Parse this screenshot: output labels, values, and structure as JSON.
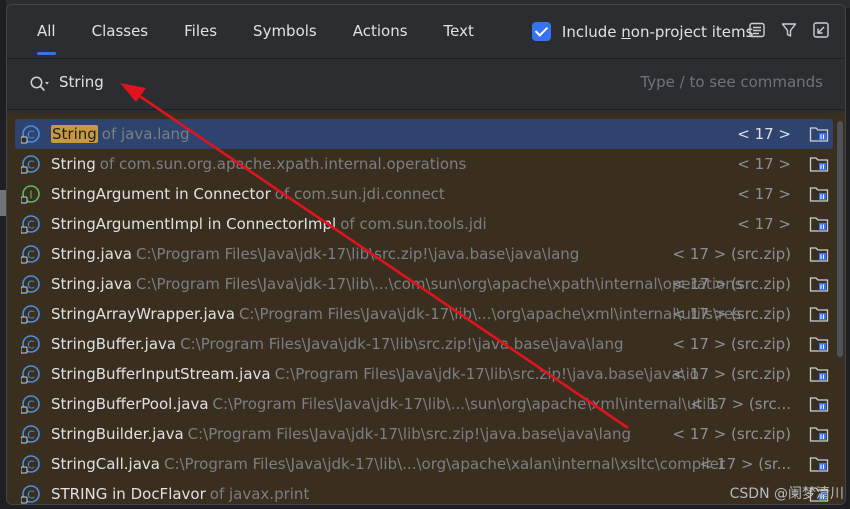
{
  "tabs": [
    {
      "label": "All",
      "active": true
    },
    {
      "label": "Classes",
      "active": false
    },
    {
      "label": "Files",
      "active": false
    },
    {
      "label": "Symbols",
      "active": false
    },
    {
      "label": "Actions",
      "active": false
    },
    {
      "label": "Text",
      "active": false
    }
  ],
  "include_option": {
    "label_pre": "Include ",
    "label_u": "n",
    "label_post": "on-project items",
    "checked": true
  },
  "toolbar_icons": [
    "preview-icon",
    "filter-icon",
    "open-in-window-icon"
  ],
  "search": {
    "value": "String",
    "hint": "Type / to see commands"
  },
  "results": [
    {
      "icon": "class",
      "name_hl": "String",
      "name": "",
      "loc": "of java.lang",
      "ver": "< 17 >",
      "selected": true
    },
    {
      "icon": "class",
      "name_hl": "",
      "name": "String",
      "loc": "of com.sun.org.apache.xpath.internal.operations",
      "ver": "< 17 >",
      "selected": false
    },
    {
      "icon": "interface",
      "name_hl": "",
      "name": "StringArgument in Connector",
      "loc": "of com.sun.jdi.connect",
      "ver": "< 17 >",
      "selected": false
    },
    {
      "icon": "class",
      "name_hl": "",
      "name": "StringArgumentImpl in ConnectorImpl",
      "loc": "of com.sun.tools.jdi",
      "ver": "< 17 >",
      "selected": false
    },
    {
      "icon": "class",
      "name_hl": "",
      "name": "String.java",
      "loc": "C:\\Program Files\\Java\\jdk-17\\lib\\src.zip!\\java.base\\java\\lang",
      "ver": "< 17 > (src.zip)",
      "selected": false
    },
    {
      "icon": "class",
      "name_hl": "",
      "name": "String.java",
      "loc": "C:\\Program Files\\Java\\jdk-17\\lib\\...\\com\\sun\\org\\apache\\xpath\\internal\\operations",
      "ver": "< 17 > (src.zip)",
      "selected": false
    },
    {
      "icon": "class",
      "name_hl": "",
      "name": "StringArrayWrapper.java",
      "loc": "C:\\Program Files\\Java\\jdk-17\\lib\\...\\org\\apache\\xml\\internal\\utils\\res",
      "ver": "< 17 > (src.zip)",
      "selected": false
    },
    {
      "icon": "class",
      "name_hl": "",
      "name": "StringBuffer.java",
      "loc": "C:\\Program Files\\Java\\jdk-17\\lib\\src.zip!\\java.base\\java\\lang",
      "ver": "< 17 > (src.zip)",
      "selected": false
    },
    {
      "icon": "class",
      "name_hl": "",
      "name": "StringBufferInputStream.java",
      "loc": "C:\\Program Files\\Java\\jdk-17\\lib\\src.zip!\\java.base\\java\\io",
      "ver": "< 17 > (src.zip)",
      "selected": false
    },
    {
      "icon": "class",
      "name_hl": "",
      "name": "StringBufferPool.java",
      "loc": "C:\\Program Files\\Java\\jdk-17\\lib\\...\\sun\\org\\apache\\xml\\internal\\utils",
      "ver": "< 17 > (src...",
      "selected": false
    },
    {
      "icon": "class",
      "name_hl": "",
      "name": "StringBuilder.java",
      "loc": "C:\\Program Files\\Java\\jdk-17\\lib\\src.zip!\\java.base\\java\\lang",
      "ver": "< 17 > (src.zip)",
      "selected": false
    },
    {
      "icon": "class",
      "name_hl": "",
      "name": "StringCall.java",
      "loc": "C:\\Program Files\\Java\\jdk-17\\lib\\...\\org\\apache\\xalan\\internal\\xsltc\\compiler",
      "ver": "< 17 > (sr...",
      "selected": false
    },
    {
      "icon": "class",
      "name_hl": "",
      "name": "STRING in DocFlavor",
      "loc": "of javax.print",
      "ver": "",
      "selected": false
    }
  ],
  "watermark": "CSDN @阑梦清川",
  "colors": {
    "accent": "#3574f0",
    "highlight": "#c79a3f",
    "annotation_arrow": "#e0141e"
  }
}
